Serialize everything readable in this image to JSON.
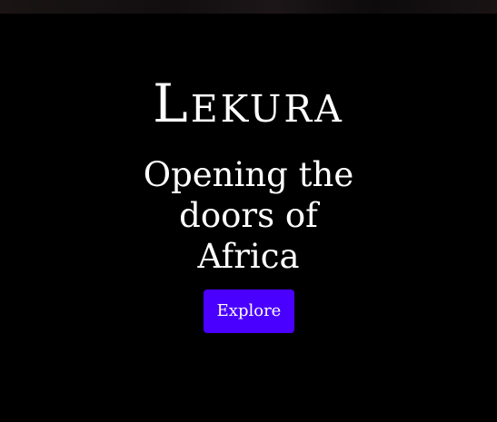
{
  "hero": {
    "brand": "Lekura",
    "tagline": "Opening the doors of Africa",
    "cta_label": "Explore"
  },
  "colors": {
    "background": "#000000",
    "text": "#ffffff",
    "accent": "#4a00ff"
  }
}
